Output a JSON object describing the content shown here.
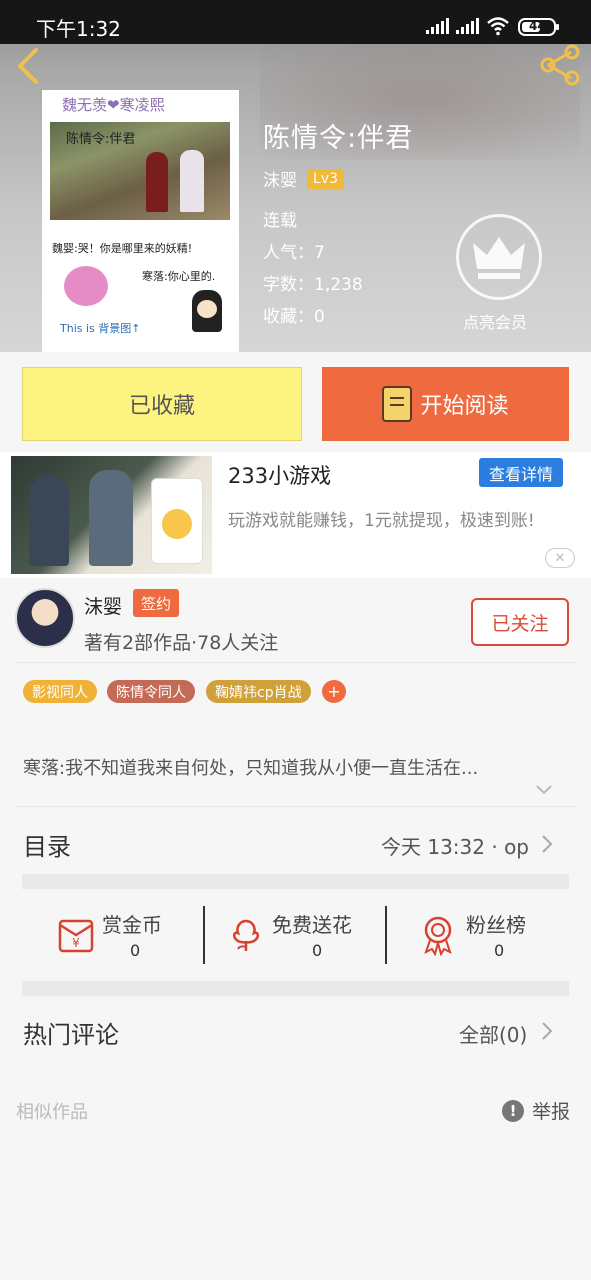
{
  "status_bar": {
    "time": "下午1:32",
    "battery": "44"
  },
  "book": {
    "title": "陈情令:伴君",
    "author": "沫婴",
    "level": "Lv3",
    "status": "连载",
    "popularity": "人气：7",
    "word_count": "字数：1,238",
    "favorites": "收藏：0",
    "vip_label": "点亮会员"
  },
  "cover": {
    "line1": "魏无羡❤寒凌熙",
    "photo_caption": "陈情令:伴君",
    "line2": "魏婴:哭！你是哪里来的妖精!",
    "line3": "寒落:你心里的.",
    "line4": "This is 背景图↑"
  },
  "actions": {
    "favorite_label": "已收藏",
    "read_label": "开始阅读"
  },
  "ad": {
    "title": "233小游戏",
    "detail_button": "查看详情",
    "description": "玩游戏就能赚钱，1元就提现，极速到账!"
  },
  "author_card": {
    "name": "沫婴",
    "sign_badge": "签约",
    "stats": "著有2部作品·78人关注",
    "follow_label": "已关注"
  },
  "tags": [
    {
      "label": "影视同人",
      "color": "#f0b137"
    },
    {
      "label": "陈情令同人",
      "color": "#c56a56"
    },
    {
      "label": "鞠婧祎cp肖战",
      "color": "#d0a13a"
    }
  ],
  "tag_add": "+",
  "synopsis": "寒落:我不知道我来自何处，只知道我从小便一直生活在...",
  "toc": {
    "title": "目录",
    "latest": "今天 13:32 · op"
  },
  "rewards": [
    {
      "label": "赏金币",
      "value": "0",
      "icon": "red-envelope-icon"
    },
    {
      "label": "免费送花",
      "value": "0",
      "icon": "flower-icon"
    },
    {
      "label": "粉丝榜",
      "value": "0",
      "icon": "award-medal-icon"
    }
  ],
  "comments": {
    "title": "热门评论",
    "all": "全部(0)"
  },
  "similar": {
    "title": "相似作品",
    "report": "举报"
  }
}
